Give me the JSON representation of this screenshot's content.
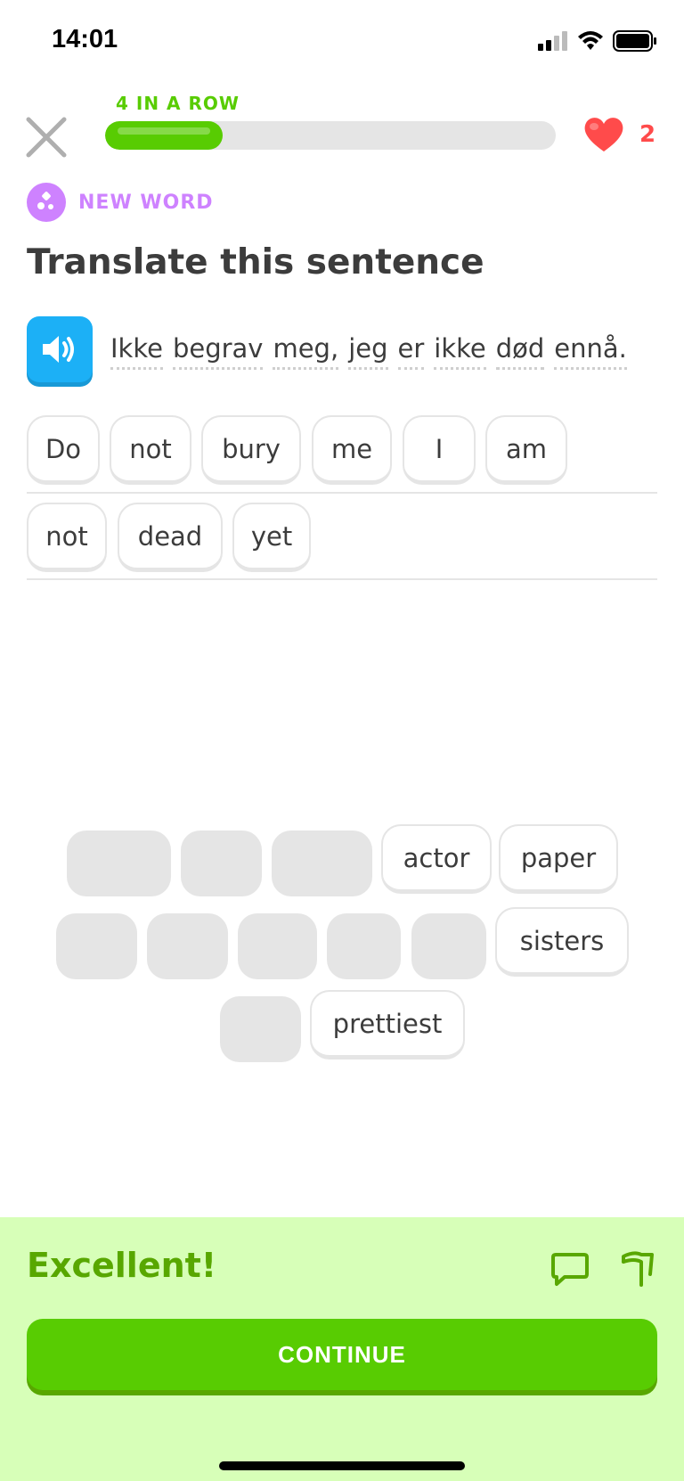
{
  "status_bar": {
    "time": "14:01"
  },
  "header": {
    "streak": "4 IN A ROW",
    "progress": 0.26,
    "hearts": "2"
  },
  "badge": {
    "label": "NEW WORD"
  },
  "prompt": {
    "title": "Translate this sentence",
    "words": [
      "Ikke",
      "begrav",
      "meg,",
      "jeg",
      "er",
      "ikke",
      "død",
      "ennå."
    ]
  },
  "answer": {
    "words": [
      "Do",
      "not",
      "bury",
      "me",
      "I",
      "am",
      "not",
      "dead",
      "yet"
    ]
  },
  "word_bank": {
    "available": [
      "actor",
      "paper",
      "sisters",
      "prettiest"
    ]
  },
  "footer": {
    "result": "Excellent!",
    "continue_label": "CONTINUE"
  },
  "colors": {
    "green": "#58cc02",
    "green_dark": "#58a700",
    "blue": "#1cb0f6",
    "purple": "#ce82ff",
    "red": "#ff4b4b",
    "footer_bg": "#d7ffb8"
  },
  "icons": [
    "close-icon",
    "heart-icon",
    "new-word-icon",
    "speaker-icon",
    "chat-icon",
    "flag-icon",
    "signal-icon",
    "wifi-icon",
    "battery-icon"
  ]
}
